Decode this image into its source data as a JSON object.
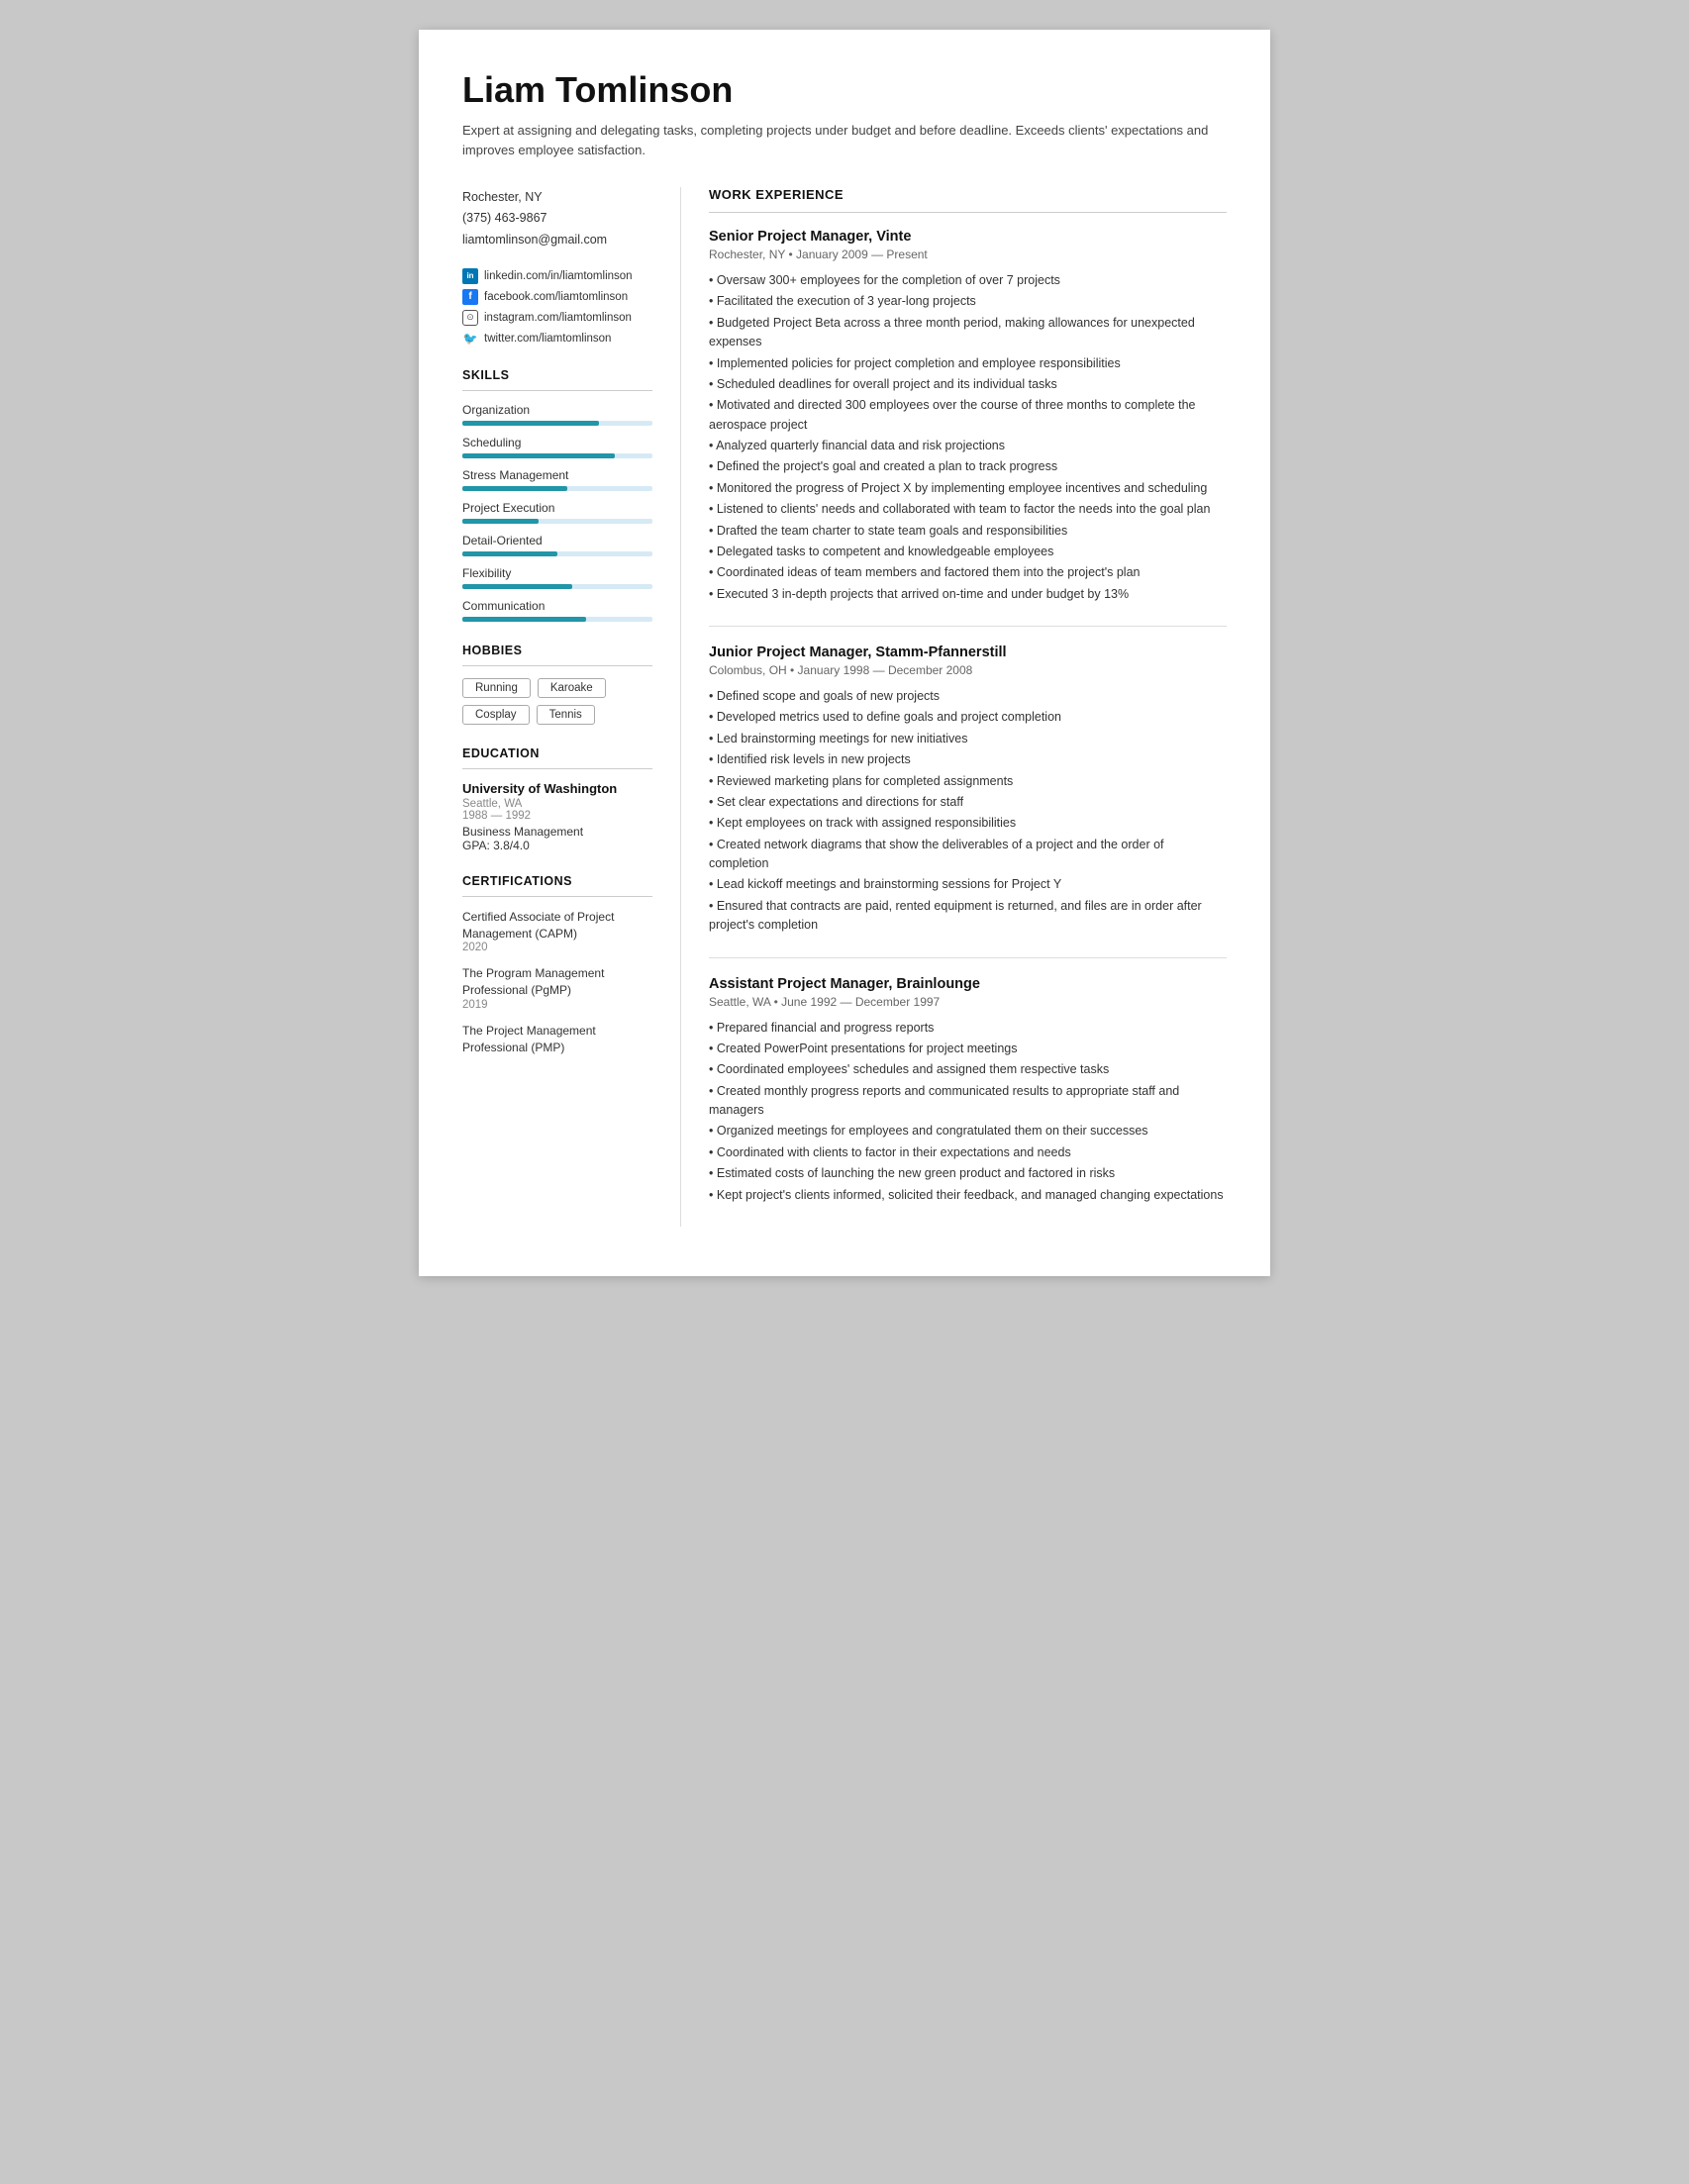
{
  "header": {
    "name": "Liam Tomlinson",
    "summary": "Expert at assigning and delegating tasks, completing projects under budget and before deadline. Exceeds clients' expectations and improves employee satisfaction."
  },
  "contact": {
    "location": "Rochester, NY",
    "phone": "(375) 463-9867",
    "email": "liamtomlinson@gmail.com"
  },
  "social": [
    {
      "platform": "linkedin",
      "label": "linkedin.com/in/liamtomlinson",
      "icon": "in"
    },
    {
      "platform": "facebook",
      "label": "facebook.com/liamtomlinson",
      "icon": "f"
    },
    {
      "platform": "instagram",
      "label": "instagram.com/liamtomlinson",
      "icon": "◻"
    },
    {
      "platform": "twitter",
      "label": "twitter.com/liamtomlinson",
      "icon": "✦"
    }
  ],
  "skills_title": "SKILLS",
  "skills": [
    {
      "name": "Organization",
      "pct": 72
    },
    {
      "name": "Scheduling",
      "pct": 80
    },
    {
      "name": "Stress Management",
      "pct": 55
    },
    {
      "name": "Project Execution",
      "pct": 40
    },
    {
      "name": "Detail-Oriented",
      "pct": 50
    },
    {
      "name": "Flexibility",
      "pct": 58
    },
    {
      "name": "Communication",
      "pct": 65
    }
  ],
  "hobbies_title": "HOBBIES",
  "hobbies": [
    "Running",
    "Karoake",
    "Cosplay",
    "Tennis"
  ],
  "education_title": "EDUCATION",
  "education": [
    {
      "school": "University of Washington",
      "location": "Seattle, WA",
      "years": "1988 — 1992",
      "field": "Business Management",
      "gpa": "GPA: 3.8/4.0"
    }
  ],
  "certifications_title": "CERTIFICATIONS",
  "certifications": [
    {
      "name": "Certified Associate of Project Management (CAPM)",
      "year": "2020"
    },
    {
      "name": "The Program Management Professional (PgMP)",
      "year": "2019"
    },
    {
      "name": "The Project Management Professional (PMP)",
      "year": ""
    }
  ],
  "work_title": "WORK EXPERIENCE",
  "jobs": [
    {
      "title": "Senior Project Manager, Vinte",
      "meta": "Rochester, NY • January 2009 — Present",
      "bullets": [
        "Oversaw 300+ employees for the completion of over 7 projects",
        "Facilitated the execution of 3 year-long projects",
        "Budgeted Project Beta across a three month period, making allowances for unexpected expenses",
        "Implemented policies for project completion and employee responsibilities",
        "Scheduled deadlines for overall project and its individual tasks",
        "Motivated and directed 300 employees over the course of three months to complete the aerospace project",
        "Analyzed quarterly financial data and risk projections",
        "Defined the project's goal and created a plan to track progress",
        "Monitored the progress of Project X by implementing employee incentives and scheduling",
        "Listened to clients' needs and collaborated with team to factor the needs into the goal plan",
        "Drafted the team charter to state team goals and responsibilities",
        "Delegated tasks to competent and knowledgeable employees",
        "Coordinated ideas of team members and factored them into the project's plan",
        "Executed 3 in-depth projects that arrived on-time and under budget by 13%"
      ]
    },
    {
      "title": "Junior Project Manager, Stamm-Pfannerstill",
      "meta": "Colombus, OH • January 1998 — December 2008",
      "bullets": [
        "Defined scope and goals of new projects",
        "Developed metrics used to define goals and project completion",
        "Led brainstorming meetings for new initiatives",
        "Identified risk levels in new projects",
        "Reviewed marketing plans for completed assignments",
        "Set clear expectations and directions for staff",
        "Kept employees on track with assigned responsibilities",
        "Created network diagrams that show the deliverables of a project and the order of completion",
        "Lead kickoff meetings and brainstorming sessions for Project Y",
        "Ensured that contracts are paid, rented equipment is returned, and files are in order after project's completion"
      ]
    },
    {
      "title": "Assistant Project Manager, Brainlounge",
      "meta": "Seattle, WA • June 1992 — December 1997",
      "bullets": [
        "Prepared financial and progress reports",
        "Created PowerPoint presentations for project meetings",
        "Coordinated employees' schedules and assigned them respective tasks",
        "Created monthly progress reports and communicated results to appropriate staff and managers",
        "Organized meetings for employees and congratulated them on their successes",
        "Coordinated with clients to factor in their expectations and needs",
        "Estimated costs of launching the new green product and factored in risks",
        "Kept project's clients informed, solicited their feedback, and managed changing expectations"
      ]
    }
  ]
}
